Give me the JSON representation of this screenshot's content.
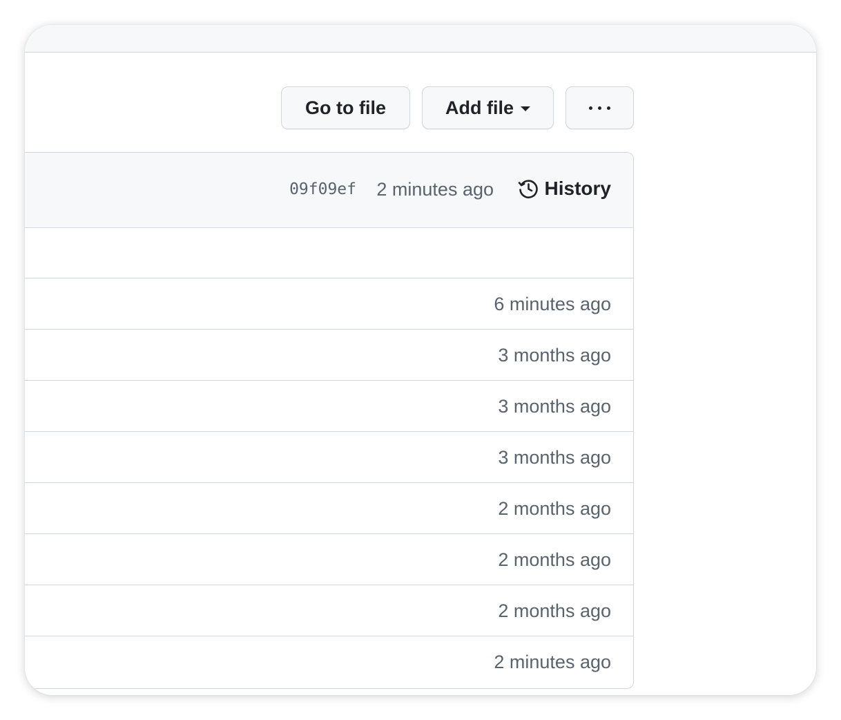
{
  "toolbar": {
    "go_to_file_label": "Go to file",
    "add_file_label": "Add file",
    "more_icon": "kebab-horizontal-icon"
  },
  "latest_commit": {
    "sha": "09f09ef",
    "time": "2 minutes ago",
    "history_label": "History",
    "history_icon": "history-icon"
  },
  "files": [
    {
      "time": ""
    },
    {
      "time": "6 minutes ago"
    },
    {
      "time": "3 months ago"
    },
    {
      "time": "3 months ago"
    },
    {
      "time": "3 months ago"
    },
    {
      "time": "2 months ago"
    },
    {
      "time": "2 months ago"
    },
    {
      "time": "2 months ago"
    },
    {
      "time": "2 minutes ago"
    }
  ],
  "colors": {
    "header_bg": "#f6f8fa",
    "border": "#d0d7de",
    "text_primary": "#1f2328",
    "text_muted": "#59636e"
  }
}
